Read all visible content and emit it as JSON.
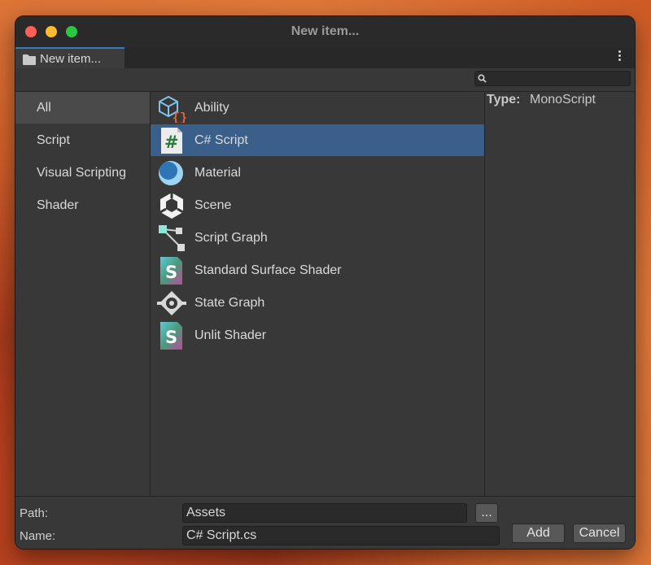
{
  "window": {
    "title": "New item..."
  },
  "tab": {
    "label": "New item...",
    "icon": "folder-icon"
  },
  "search": {
    "value": "",
    "placeholder": ""
  },
  "sidebar": {
    "items": [
      {
        "label": "All",
        "selected": true
      },
      {
        "label": "Script",
        "selected": false
      },
      {
        "label": "Visual Scripting",
        "selected": false
      },
      {
        "label": "Shader",
        "selected": false
      }
    ]
  },
  "items": [
    {
      "label": "Ability",
      "icon": "ability-icon"
    },
    {
      "label": "C# Script",
      "icon": "csharp-script-icon",
      "selected": true
    },
    {
      "label": "Material",
      "icon": "material-icon"
    },
    {
      "label": "Scene",
      "icon": "scene-icon"
    },
    {
      "label": "Script Graph",
      "icon": "script-graph-icon"
    },
    {
      "label": "Standard Surface Shader",
      "icon": "shader-icon"
    },
    {
      "label": "State Graph",
      "icon": "state-graph-icon"
    },
    {
      "label": "Unlit Shader",
      "icon": "shader-icon"
    }
  ],
  "details": {
    "type_key": "Type:",
    "type_value": "MonoScript"
  },
  "footer": {
    "path_label": "Path:",
    "path_value": "Assets",
    "browse_label": "...",
    "name_label": "Name:",
    "name_value": "C# Script.cs",
    "add_label": "Add",
    "cancel_label": "Cancel"
  },
  "colors": {
    "accent": "#3a5f8a",
    "close": "#fe5f57",
    "minimize": "#febc2e",
    "maximize": "#28c840"
  }
}
